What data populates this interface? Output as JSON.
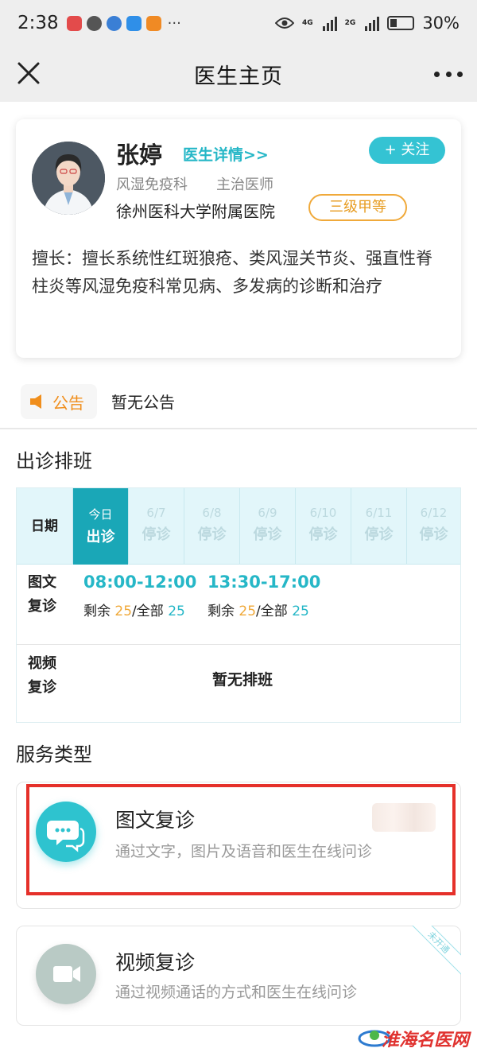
{
  "status_bar": {
    "time": "2:38",
    "more": "···",
    "battery": "30%",
    "net1": "4G",
    "net2": "2G"
  },
  "nav": {
    "title": "医生主页"
  },
  "doctor": {
    "name": "张婷",
    "detail_link": "医生详情>>",
    "follow_label": "+ 关注",
    "department": "风湿免疫科",
    "title": "主治医师",
    "hospital": "徐州医科大学附属医院",
    "hospital_grade": "三级甲等",
    "specialty": "擅长：擅长系统性红斑狼疮、类风湿关节炎、强直性脊柱炎等风湿免疫科常见病、多发病的诊断和治疗"
  },
  "notice": {
    "label": "公告",
    "text": "暂无公告"
  },
  "schedule": {
    "section_title": "出诊排班",
    "date_label": "日期",
    "days": [
      {
        "date": "今日",
        "status": "出诊"
      },
      {
        "date": "6/7",
        "status": "停诊"
      },
      {
        "date": "6/8",
        "status": "停诊"
      },
      {
        "date": "6/9",
        "status": "停诊"
      },
      {
        "date": "6/10",
        "status": "停诊"
      },
      {
        "date": "6/11",
        "status": "停诊"
      },
      {
        "date": "6/12",
        "status": "停诊"
      }
    ],
    "text_row_label": "图文复诊",
    "slots": [
      {
        "time": "08:00-12:00",
        "remain_label": "剩余 ",
        "remain": "25",
        "total_label": "/全部 ",
        "total": "25"
      },
      {
        "time": "13:30-17:00",
        "remain_label": "剩余 ",
        "remain": "25",
        "total_label": "/全部 ",
        "total": "25"
      }
    ],
    "video_row_label": "视频复诊",
    "video_empty": "暂无排班"
  },
  "services": {
    "section_title": "服务类型",
    "items": [
      {
        "name": "图文复诊",
        "desc": "通过文字，图片及语音和医生在线问诊",
        "color": "#2ec3cf"
      },
      {
        "name": "视频复诊",
        "desc": "通过视频通话的方式和医生在线问诊",
        "color": "#b9cac5",
        "ribbon": "未开通"
      }
    ]
  },
  "watermark": "淮海名医网",
  "colors": {
    "accent": "#26b7c7",
    "orange": "#f0a93a",
    "highlight": "#e5302a"
  }
}
